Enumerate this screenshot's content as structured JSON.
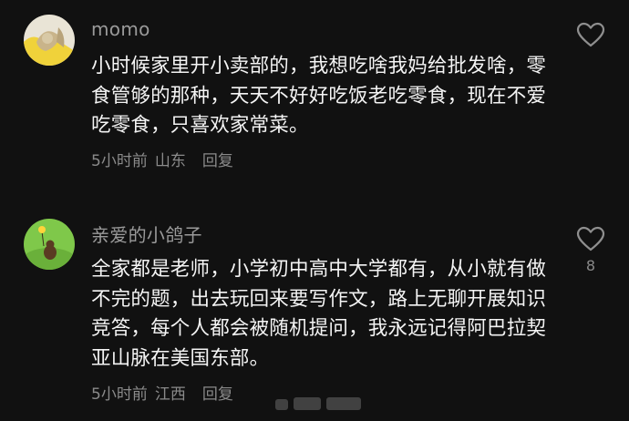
{
  "comments": [
    {
      "username": "momo",
      "text": "小时候家里开小卖部的，我想吃啥我妈给批发啥，零食管够的那种，天天不好好吃饭老吃零食，现在不爱吃零食，只喜欢家常菜。",
      "time": "5小时前",
      "location": "山东",
      "reply_label": "回复",
      "like_count": ""
    },
    {
      "username": "亲爱的小鸽子",
      "text": "全家都是老师，小学初中高中大学都有，从小就有做不完的题，出去玩回来要写作文，路上无聊开展知识竞答，每个人都会被随机提问，我永远记得阿巴拉契亚山脉在美国东部。",
      "time": "5小时前",
      "location": "江西",
      "reply_label": "回复",
      "like_count": "8"
    }
  ],
  "icons": {
    "like": "heart-outline-icon"
  },
  "colors": {
    "background": "#111111",
    "text": "#f4f4f4",
    "muted": "#8a8a8a"
  }
}
